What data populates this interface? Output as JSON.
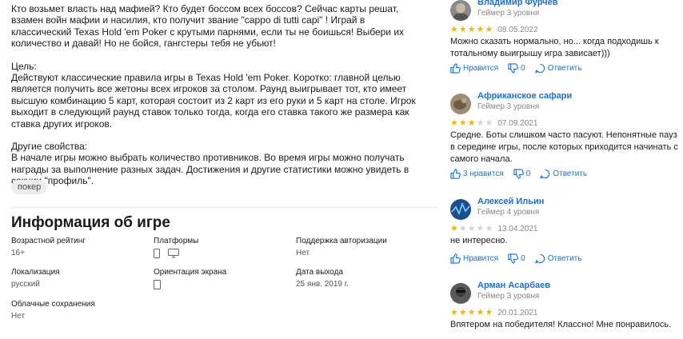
{
  "description": {
    "intro": "Кто возьмет власть над мафией? Кто будет боссом всех боссов? Сейчас карты решат, взамен войн мафии и насилия, кто получит звание \"cappo di tutti capi\" ! Играй в классический Texas Hold 'em Poker с крутыми парнями, если ты не боишься! Выбери их количество и давай! Но не бойся, гангстеры тебя не убьют!",
    "goal_heading": "Цель:",
    "goal_text": "Действуют классические правила игры в Texas Hold 'em Poker. Коротко: главной целью является получить все жетоны всех игроков за столом. Раунд выигрывает тот, кто имеет высшую комбинацию 5 карт, которая состоит из 2 карт из его руки и 5 карт на столе. Игрок выходит в следующий раунд ставок только тогда, когда его ставка такого же размера как ставка других игроков.",
    "features_heading": "Другие свойства:",
    "features_text": "В начале игры можно выбрать количество противников. Во время игры можно получать награды за выполнение разных задач. Достижения и другие статистики можно увидеть в секции \"профиль\"."
  },
  "tag": "покер",
  "info": {
    "title": "Информация об игре",
    "age_label": "Возрастной рейтинг",
    "age_value": "16+",
    "platforms_label": "Платформы",
    "auth_label": "Поддержка авторизации",
    "auth_value": "Нет",
    "locale_label": "Локализация",
    "locale_value": "русский",
    "orientation_label": "Ориентация экрана",
    "release_label": "Дата выхода",
    "release_value": "25 янв. 2019 г.",
    "cloud_label": "Облачные сохранения",
    "cloud_value": "Нет"
  },
  "reviews": [
    {
      "name": "Владимир Фурчев",
      "level": "Геймер 3 уровня",
      "rating": 5,
      "date": "08.05.2022",
      "text": "Можно сказать нормально, но... когда подходишь к тотальному выигрышу игра зависает)))",
      "likes_label": "Нравится",
      "dislikes": "0",
      "reply": "Ответить"
    },
    {
      "name": "Африканское сафари",
      "level": "Геймер 3 уровня",
      "rating": 3,
      "date": "07.09.2021",
      "text": "Средне. Боты слишком часто пасуют. Непонятные пауз в середине игры, после которых приходится начинать с самого начала.",
      "likes_label": "3 нравится",
      "dislikes": "0",
      "reply": "Ответить"
    },
    {
      "name": "Алексей Ильин",
      "level": "Геймер 4 уровня",
      "rating": 1,
      "date": "13.04.2021",
      "text": "не интересно.",
      "likes_label": "Нравится",
      "dislikes": "0",
      "reply": "Ответить"
    },
    {
      "name": "Арман Асарбаев",
      "level": "Геймер 3 уровня",
      "rating": 5,
      "date": "20.01.2021",
      "text": "Впятером на победителя! Классно! Мне понравилось.",
      "likes_label": "",
      "dislikes": "",
      "reply": ""
    }
  ],
  "colors": {
    "link": "#1a6fd6",
    "star": "#f5b800",
    "star_empty": "#d3d3d3"
  }
}
